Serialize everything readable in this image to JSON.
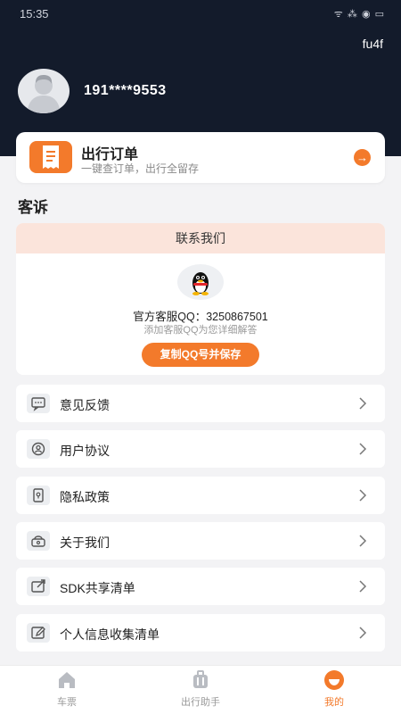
{
  "status_bar": {
    "time": "15:35",
    "icons": "ᯤ ⁂ ◉ ▭"
  },
  "header": {
    "corner_text": "fu4f",
    "phone": "191****9553"
  },
  "order_card": {
    "title": "出行订单",
    "subtitle": "一键查订单，出行全留存",
    "arrow": "→"
  },
  "complaint": {
    "section_title": "客诉",
    "card_title": "联系我们",
    "qq_line": "官方客服QQ：3250867501",
    "qq_hint": "添加客服QQ为您详细解答",
    "copy_button": "复制QQ号并保存"
  },
  "menu": [
    {
      "label": "意见反馈",
      "icon": "feedback-icon"
    },
    {
      "label": "用户协议",
      "icon": "user-agreement-icon"
    },
    {
      "label": "隐私政策",
      "icon": "privacy-icon"
    },
    {
      "label": "关于我们",
      "icon": "about-icon"
    },
    {
      "label": "SDK共享清单",
      "icon": "sdk-share-icon"
    },
    {
      "label": "个人信息收集清单",
      "icon": "edit-icon"
    }
  ],
  "bottom_nav": [
    {
      "label": "车票",
      "icon": "home-icon",
      "active": false
    },
    {
      "label": "出行助手",
      "icon": "luggage-icon",
      "active": false
    },
    {
      "label": "我的",
      "icon": "profile-icon",
      "active": true
    }
  ],
  "colors": {
    "accent": "#f37a2b",
    "header_bg": "#131b2b",
    "page_bg": "#f3f3f5"
  }
}
